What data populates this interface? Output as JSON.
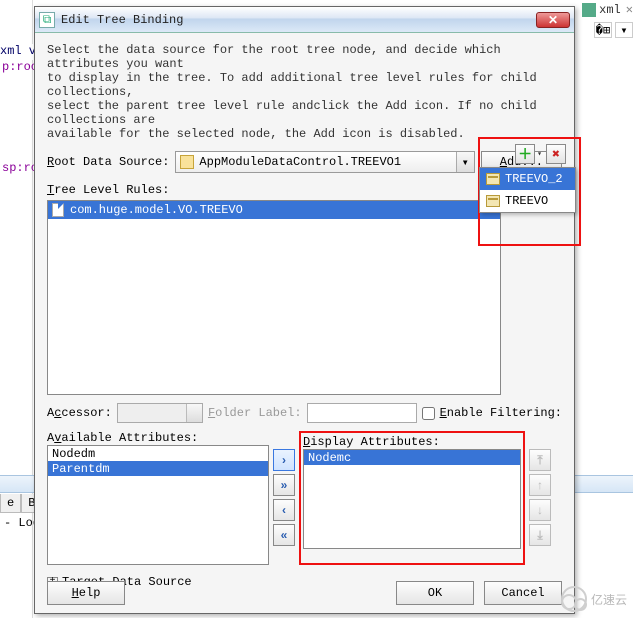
{
  "bg": {
    "tab_name": "xml",
    "tab_x": "✕",
    "xml_decl": "xml ve",
    "jsp_root": "p:roo",
    "jsp_root2": "sp:ro",
    "tab2_a": "e",
    "tab2_b": "Bi",
    "log": "- Log"
  },
  "dialog": {
    "title": "Edit Tree Binding",
    "close": "✕",
    "instructions": "Select the data source for the root tree node, and decide which attributes you want\nto display in the tree. To add additional tree level rules for child collections,\nselect the parent tree level rule andclick the Add icon. If no child collections are\navailable for the selected node, the Add icon is disabled.",
    "root_label": "Root Data Source:",
    "root_value": "AppModuleDataControl.TREEVO1",
    "add_btn": "Add...",
    "rules_label": "Tree Level Rules:",
    "rule_item": "com.huge.model.VO.TREEVO",
    "popup": {
      "item1": "TREEVO_2",
      "item2": "TREEVO"
    },
    "accessor_label": "Accessor:",
    "folder_label": "Folder Label:",
    "filter_label": "Enable Filtering:",
    "avail_label": "Available Attributes:",
    "avail_items": {
      "a": "Nodedm",
      "b": "Parentdm"
    },
    "disp_label": "Display Attributes:",
    "disp_items": {
      "a": "Nodemc"
    },
    "tds_label": "Target Data Source",
    "help": "Help",
    "ok": "OK",
    "cancel": "Cancel"
  },
  "watermark": "亿速云"
}
